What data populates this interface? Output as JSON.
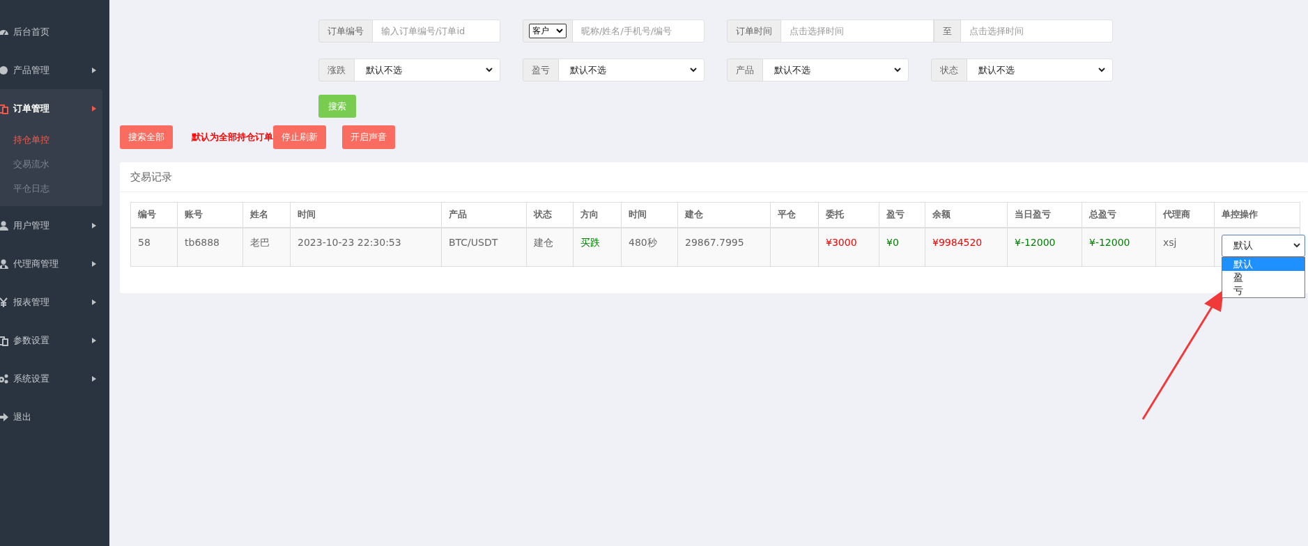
{
  "sidebar": {
    "items": [
      {
        "label": "后台首页",
        "selected": false,
        "has_children": false
      },
      {
        "label": "产品管理",
        "selected": false,
        "has_children": true
      },
      {
        "label": "订单管理",
        "selected": true,
        "expanded": true,
        "has_children": true,
        "children": [
          {
            "label": "持仓单控",
            "selected": true
          },
          {
            "label": "交易流水",
            "selected": false
          },
          {
            "label": "平仓日志",
            "selected": false
          }
        ]
      },
      {
        "label": "用户管理",
        "selected": false,
        "has_children": true
      },
      {
        "label": "代理商管理",
        "selected": false,
        "has_children": true
      },
      {
        "label": "报表管理",
        "selected": false,
        "has_children": true
      },
      {
        "label": "参数设置",
        "selected": false,
        "has_children": true
      },
      {
        "label": "系统设置",
        "selected": false,
        "has_children": true
      },
      {
        "label": "退出",
        "selected": false,
        "has_children": false
      }
    ]
  },
  "filters": {
    "rows": [
      [
        {
          "kind": "input",
          "label": "订单编号",
          "placeholder": "输入订单编号/订单id"
        },
        {
          "kind": "select-input",
          "select": "客户",
          "placeholder": "昵称/姓名/手机号/编号"
        },
        {
          "kind": "range",
          "label": "订单时间",
          "placeholder": "点击选择时间",
          "separator": "至",
          "placeholder_2": "点击选择时间"
        }
      ],
      [
        {
          "kind": "select",
          "label": "涨跌",
          "value": "默认不选"
        },
        {
          "kind": "select",
          "label": "盈亏",
          "value": "默认不选"
        },
        {
          "kind": "select",
          "label": "产品",
          "value": "默认不选"
        },
        {
          "kind": "select",
          "label": "状态",
          "value": "默认不选"
        }
      ]
    ],
    "search_button": "搜索"
  },
  "actions": [
    {
      "kind": "button",
      "label": "搜索全部"
    },
    {
      "kind": "note",
      "label": "默认为全部持仓订单"
    },
    {
      "kind": "button",
      "label": "停止刷新"
    },
    {
      "kind": "button",
      "label": "开启声音"
    }
  ],
  "panel": {
    "title": "交易记录",
    "table": {
      "columns": [
        "编号",
        "账号",
        "姓名",
        "时间",
        "产品",
        "状态",
        "方向",
        "时间",
        "建仓",
        "平仓",
        "委托",
        "盈亏",
        "余额",
        "当日盈亏",
        "总盈亏",
        "代理商",
        "单控操作"
      ],
      "rows": [
        {
          "cells": [
            {
              "text": "58"
            },
            {
              "text": "tb6888"
            },
            {
              "text": "老巴"
            },
            {
              "text": "2023-10-23 22:30:53"
            },
            {
              "text": "BTC/USDT"
            },
            {
              "text": "建仓"
            },
            {
              "text": "买跌",
              "color": "#008000"
            },
            {
              "text": "480秒"
            },
            {
              "text": "29867.7995"
            },
            {},
            {
              "text": "¥3000",
              "color": "#ff0000"
            },
            {
              "text": "¥0",
              "color": "#008000"
            },
            {
              "text": "¥9984520",
              "color": "#ff0000"
            },
            {
              "text": "¥-12000",
              "color": "#008000"
            },
            {
              "text": "¥-12000",
              "color": "#008000"
            },
            {
              "text": "xsj"
            }
          ],
          "control": {
            "value": "默认",
            "open": true,
            "options": [
              {
                "label": "默认",
                "selected": true
              },
              {
                "label": "盈",
                "selected": false
              },
              {
                "label": "亏",
                "selected": false
              }
            ]
          }
        }
      ]
    }
  }
}
